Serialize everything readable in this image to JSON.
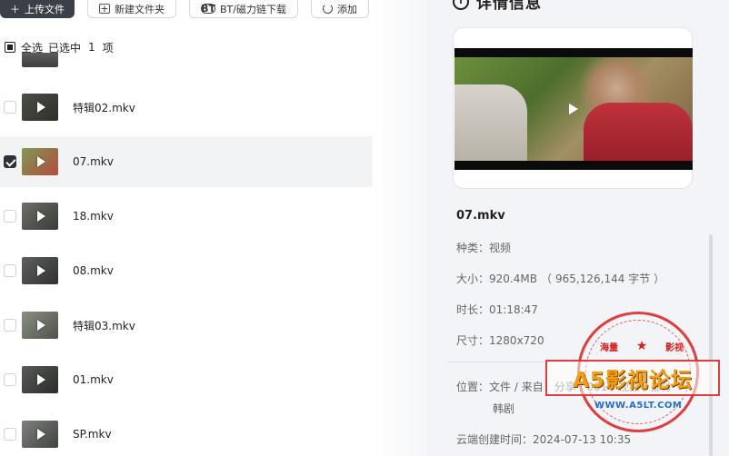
{
  "toolbar": {
    "upload_label": "上传文件",
    "new_folder_label": "新建文件夹",
    "bt_label": "BT/磁力链下载",
    "refresh_label": "添加"
  },
  "selection": {
    "select_all_label": "全选",
    "selected_prefix": "已选中",
    "selected_count": "1",
    "selected_suffix": "项"
  },
  "files": [
    {
      "name": "特辑02.mkv",
      "checked": false,
      "selected": false
    },
    {
      "name": "07.mkv",
      "checked": true,
      "selected": true
    },
    {
      "name": "18.mkv",
      "checked": false,
      "selected": false
    },
    {
      "name": "08.mkv",
      "checked": false,
      "selected": false
    },
    {
      "name": "特辑03.mkv",
      "checked": false,
      "selected": false
    },
    {
      "name": "01.mkv",
      "checked": false,
      "selected": false
    },
    {
      "name": "SP.mkv",
      "checked": false,
      "selected": false
    }
  ],
  "detail": {
    "title": "详情信息",
    "file_name": "07.mkv",
    "type_label": "种类",
    "type_value": "视频",
    "size_label": "大小",
    "size_value": "920.4MB",
    "size_bytes": "965,126,144 字节",
    "duration_label": "时长",
    "duration_value": "01:18:47",
    "dimension_label": "尺寸",
    "dimension_value": "1280x720",
    "location_label": "位置",
    "location_value": "文件 / 来自：分享 / 001 / 视频 / 部分",
    "location_cont": "韩剧",
    "created_label": "云端创建时间",
    "created_value": "2024-07-13 10:35"
  },
  "watermark": {
    "top_left": "海量",
    "top_right": "影视",
    "main": "A5影视论坛",
    "url": "WWW.A5LT.COM"
  },
  "colors": {
    "primary_button": "#3b3f48",
    "panel_bg": "#f3f4f7",
    "selected_row": "#f2f3f5",
    "stamp_red": "#d81e1e",
    "stamp_gold": "#f0a012"
  }
}
